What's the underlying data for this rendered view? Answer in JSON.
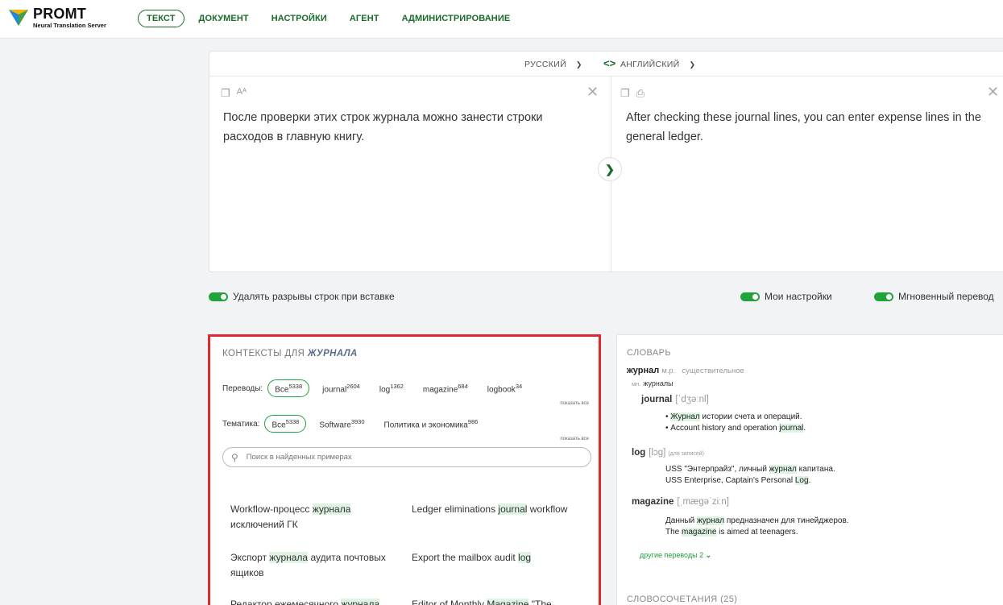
{
  "header": {
    "brand": "PROMT",
    "subtitle": "Neural Translation Server",
    "nav": [
      "ТЕКСТ",
      "ДОКУМЕНТ",
      "НАСТРОЙКИ",
      "АГЕНТ",
      "АДМИНИСТРИРОВАНИЕ"
    ]
  },
  "translator": {
    "source_lang": "РУССКИЙ",
    "target_lang": "АНГЛИЙСКИЙ",
    "source_text": "После проверки этих строк журнала можно занести строки расходов в главную книгу.",
    "target_text": "After checking these journal lines, you can enter expense lines in the general ledger."
  },
  "toggles": {
    "remove_breaks": "Удалять разрывы строк при вставке",
    "my_settings": "Мои настройки",
    "instant": "Мгновенный перевод"
  },
  "contexts": {
    "title_prefix": "КОНТЕКСТЫ ДЛЯ",
    "title_word": "ЖУРНАЛА",
    "translations_label": "Переводы:",
    "translations": [
      {
        "label": "Все",
        "count": "5338"
      },
      {
        "label": "journal",
        "count": "2604"
      },
      {
        "label": "log",
        "count": "1362"
      },
      {
        "label": "magazine",
        "count": "684"
      },
      {
        "label": "logbook",
        "count": "34"
      }
    ],
    "topics_label": "Тематика:",
    "topics": [
      {
        "label": "Все",
        "count": "5338"
      },
      {
        "label": "Software",
        "count": "3930"
      },
      {
        "label": "Политика и экономика",
        "count": "986"
      }
    ],
    "show_all": "показать все",
    "search_placeholder": "Поиск в найденных примерах",
    "examples": [
      {
        "ru_pre": "Workflow-процесс ",
        "ru_hl": "журнала",
        "ru_post": " исключений ГК",
        "en_pre": "Ledger eliminations ",
        "en_hl": "journal",
        "en_post": " workflow"
      },
      {
        "ru_pre": "Экспорт ",
        "ru_hl": "журнала",
        "ru_post": " аудита почтовых ящиков",
        "en_pre": "Export the mailbox audit ",
        "en_hl": "log",
        "en_post": ""
      },
      {
        "ru_pre": "Редактор ежемесячного ",
        "ru_hl": "журнала",
        "ru_post": "",
        "en_pre": "Editor of Monthly ",
        "en_hl": "Magazine",
        "en_post": " \"The"
      }
    ]
  },
  "dictionary": {
    "title": "СЛОВАРЬ",
    "headword": "журнал",
    "gender": "м.р.",
    "pos": "существительное",
    "plural_label": "мн.",
    "plural": "журналы",
    "entries": [
      {
        "word": "journal",
        "ipa": "[ˈdʒəːnl]",
        "note": "",
        "ru_pre": "• ",
        "ru_hl": "Журнал",
        "ru_post": " истории счета и операций.",
        "en_pre": "• Account history and operation ",
        "en_hl": "journal",
        "en_post": "."
      },
      {
        "word": "log",
        "ipa": "[lɔg]",
        "note": "(для записей)",
        "ru_pre": "USS \"Энтерпрайз\", личный ",
        "ru_hl": "журнал",
        "ru_post": " капитана.",
        "en_pre": "USS Enterprise, Captain's Personal ",
        "en_hl": "Log",
        "en_post": "."
      },
      {
        "word": "magazine",
        "ipa": "[ˌmægəˈziːn]",
        "note": "",
        "ru_pre": "Данный ",
        "ru_hl": "журнал",
        "ru_post": " предназначен для тинейджеров.",
        "en_pre": "The ",
        "en_hl": "magazine",
        "en_post": " is aimed at teenagers."
      }
    ],
    "more": "другие переводы 2",
    "phrases_title": "СЛОВОСОЧЕТАНИЯ (25)"
  }
}
